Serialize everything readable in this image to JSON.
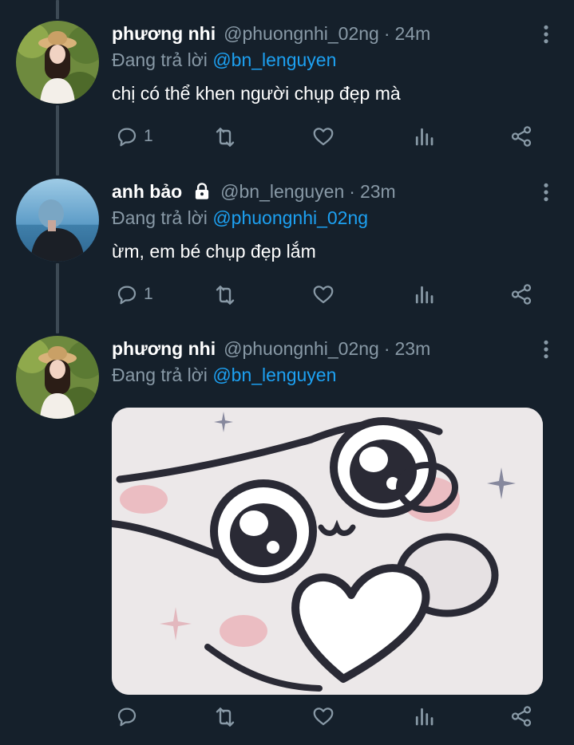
{
  "tweets": [
    {
      "display_name": "phương nhi",
      "handle": "@phuongnhi_02ng",
      "separator": "·",
      "time": "24m",
      "replying_prefix": "Đang trả lời ",
      "replying_to": "@bn_lenguyen",
      "text": "chị có thể khen người chụp đẹp mà",
      "reply_count": "1",
      "locked": false
    },
    {
      "display_name": "anh bảo",
      "handle": "@bn_lenguyen",
      "separator": "·",
      "time": "23m",
      "replying_prefix": "Đang trả lời ",
      "replying_to": "@phuongnhi_02ng",
      "text": "ừm, em bé chụp đẹp lắm",
      "reply_count": "1",
      "locked": true
    },
    {
      "display_name": "phương nhi",
      "handle": "@phuongnhi_02ng",
      "separator": "·",
      "time": "23m",
      "replying_prefix": "Đang trả lời ",
      "replying_to": "@bn_lenguyen",
      "reply_count": "",
      "has_media": true
    }
  ],
  "icons": {
    "reply": "reply-icon",
    "retweet": "retweet-icon",
    "like": "heart-icon",
    "analytics": "analytics-icon",
    "share": "share-icon",
    "more": "more-vertical-icon",
    "lock": "lock-icon"
  },
  "colors": {
    "background": "#15202b",
    "secondary_text": "#8899a6",
    "link": "#1da1f2",
    "thread_line": "#3d4a55"
  }
}
